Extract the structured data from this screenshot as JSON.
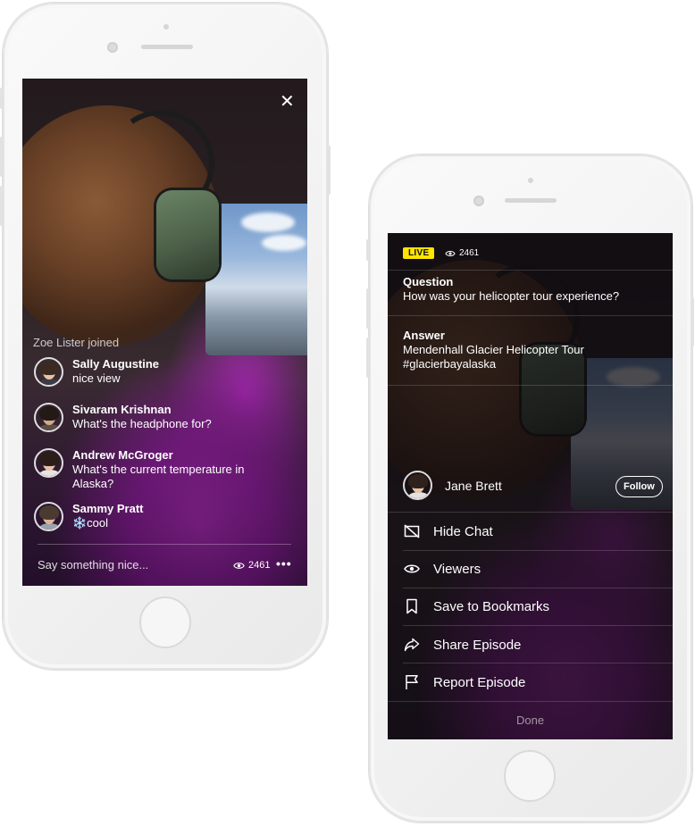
{
  "left_screen": {
    "joined_notice": "Zoe Lister joined",
    "messages": [
      {
        "name": "Sally Augustine",
        "text": "nice view"
      },
      {
        "name": "Sivaram Krishnan",
        "text": "What's the headphone for?"
      },
      {
        "name": "Andrew McGroger",
        "text": "What's the current temperature in",
        "text2": "Alaska?"
      },
      {
        "name": "Sammy Pratt",
        "text": "❄️cool"
      }
    ],
    "composer_placeholder": "Say something nice...",
    "view_count": "2461",
    "more_label": "•••",
    "close_label": "✕"
  },
  "right_screen": {
    "live_badge": "LIVE",
    "view_count": "2461",
    "question_title": "Question",
    "question_text": "How was your helicopter tour experience?",
    "answer_title": "Answer",
    "answer_line1": "Mendenhall Glacier Helicopter Tour",
    "answer_line2": "#glacierbayalaska",
    "host_name": "Jane Brett",
    "follow_label": "Follow",
    "menu": [
      {
        "label": "Hide Chat",
        "icon": "hide-chat-icon"
      },
      {
        "label": "Viewers",
        "icon": "eye-icon"
      },
      {
        "label": "Save to Bookmarks",
        "icon": "bookmark-icon"
      },
      {
        "label": "Share Episode",
        "icon": "share-arrow-icon"
      },
      {
        "label": "Report Episode",
        "icon": "flag-icon"
      }
    ],
    "done_label": "Done"
  },
  "colors": {
    "live_badge": "#ffe400",
    "jacket_purple": "#9b27a6",
    "device_frame": "#f4f4f4"
  }
}
